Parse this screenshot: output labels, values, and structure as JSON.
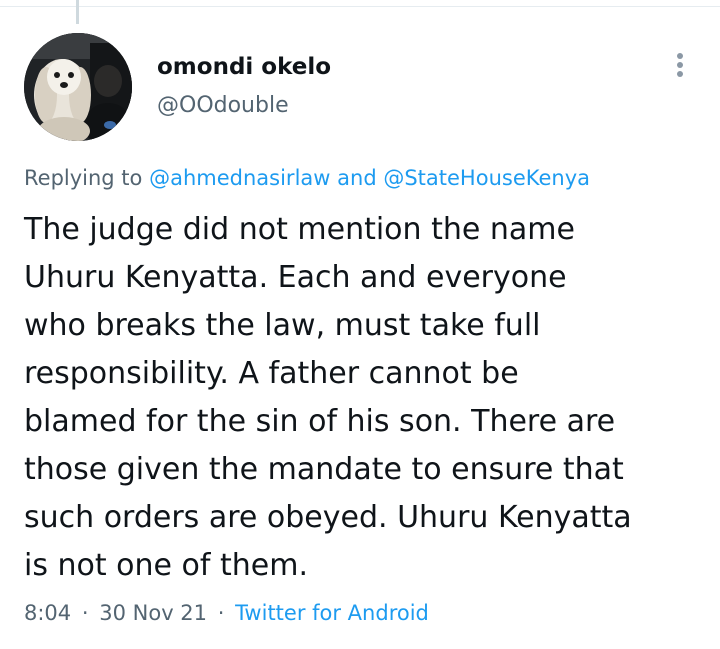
{
  "author": {
    "display_name": "omondi okelo",
    "handle": "@OOdouble"
  },
  "icons": {
    "avatar": "profile-photo-dog",
    "more": "more-options-vertical-dots-icon"
  },
  "reply": {
    "prefix": "Replying to",
    "mention1": "@ahmednasirlaw",
    "conjunction": "and",
    "mention2": "@StateHouseKenya"
  },
  "tweet": {
    "text": "The judge did not mention the name\nUhuru Kenyatta. Each and everyone\nwho breaks the law, must  take full\nresponsibility. A father cannot be\nblamed for the sin of his son. There are\nthose given the mandate to ensure that\nsuch orders are obeyed. Uhuru Kenyatta\nis not one of them."
  },
  "meta": {
    "time": "8:04",
    "separator": "·",
    "date": "30 Nov 21",
    "source": "Twitter for Android"
  },
  "colors": {
    "text": "#0f1419",
    "secondary": "#536471",
    "link": "#1d9bf0"
  }
}
